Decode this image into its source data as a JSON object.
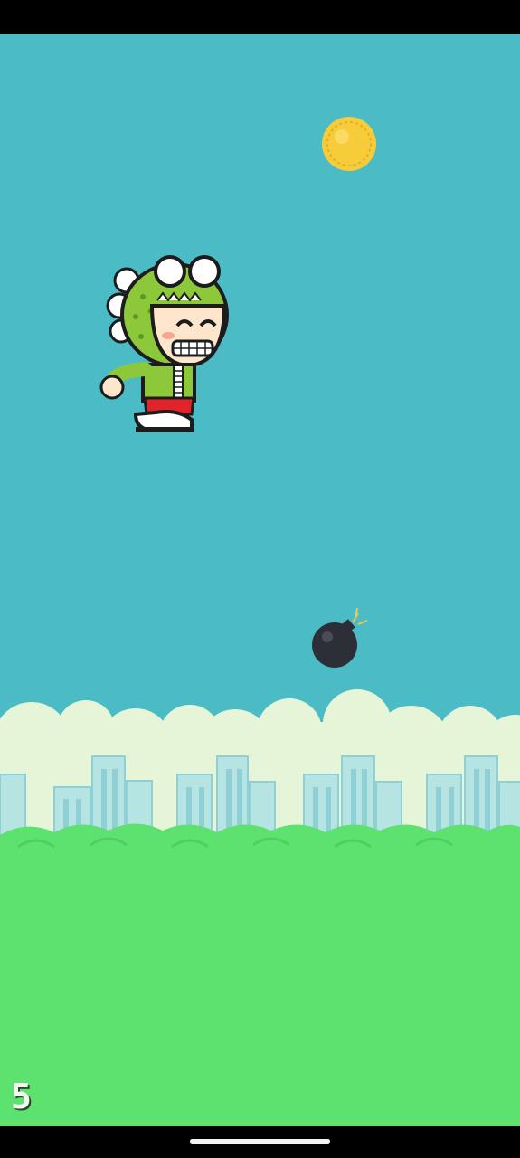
{
  "game": {
    "score": "5",
    "sky_color": "#4bbcc6",
    "ground_color": "#5de270",
    "cloud_color": "#e6f5d8",
    "building_color": "#a8dde0",
    "coin_color": "#f7cc3a",
    "bomb_color": "#2d2f38",
    "character": "dino-costume-kid"
  }
}
